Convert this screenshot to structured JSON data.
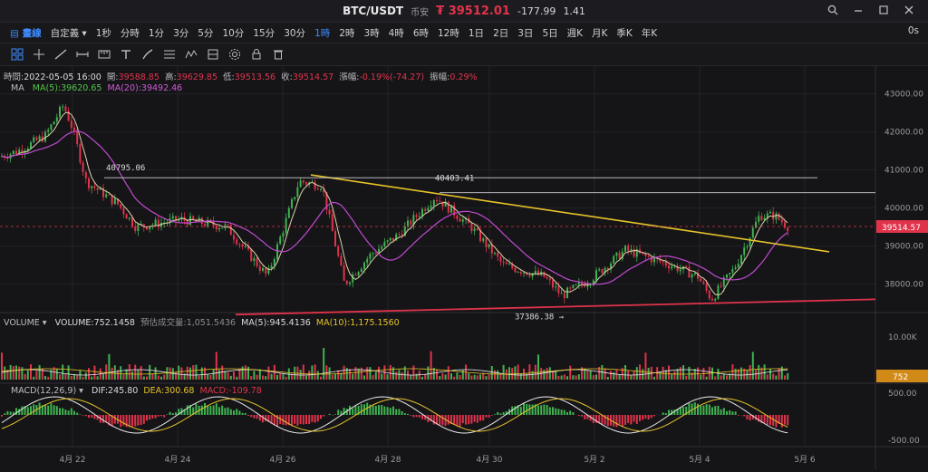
{
  "title": {
    "pair": "BTC/USDT",
    "venue": "币安",
    "price_symbol": "₮",
    "price": "39512.01",
    "change": "-177.99",
    "change_pct": "1.41"
  },
  "window": {
    "icons": [
      "search-icon",
      "minimize-icon",
      "restore-icon",
      "close-icon"
    ]
  },
  "intervals": {
    "brand": "畫線",
    "custom": "自定義",
    "items": [
      "1秒",
      "分時",
      "1分",
      "3分",
      "5分",
      "10分",
      "15分",
      "30分",
      "1時",
      "2時",
      "3時",
      "4時",
      "6時",
      "12時",
      "1日",
      "2日",
      "3日",
      "5日",
      "週K",
      "月K",
      "季K",
      "年K"
    ],
    "active": "1時",
    "seconds_badge": "0s"
  },
  "tools": [
    "grid-icon",
    "cursor-icon",
    "trendline-icon",
    "horizontal-line-icon",
    "ruler-icon",
    "text-icon",
    "brush-icon",
    "fib-icon",
    "pattern-icon",
    "layers-icon",
    "settings-icon",
    "lock-icon",
    "trash-icon"
  ],
  "ohlc": {
    "time_label": "時間:",
    "time": "2022-05-05 16:00",
    "open_label": "開:",
    "open": "39588.85",
    "high_label": "高:",
    "high": "39629.85",
    "low_label": "低:",
    "low": "39513.56",
    "close_label": "收:",
    "close": "39514.57",
    "change_label": "漲幅:",
    "change": "-0.19%(-74.27)",
    "amp_label": "振幅:",
    "amp": "0.29%"
  },
  "ma_legend": {
    "label": "MA",
    "ma5": "MA(5):39620.65",
    "ma20": "MA(20):39492.46"
  },
  "volume_legend": {
    "label": "VOLUME",
    "value": "VOLUME:752.1458",
    "estimate": "預估成交量:1,051.5436",
    "ma5": "MA(5):945.4136",
    "ma10": "MA(10):1,175.1560"
  },
  "macd_legend": {
    "label": "MACD(12,26,9)",
    "dif": "DIF:245.80",
    "dea": "DEA:300.68",
    "macd": "MACD:-109.78"
  },
  "price_axis": [
    "43000.00",
    "42000.00",
    "41000.00",
    "40000.00",
    "39000.00",
    "38000.00"
  ],
  "price_tag": "39514.57",
  "volume_axis": [
    "10.00K"
  ],
  "volume_tag": "752",
  "macd_axis": [
    "500.00",
    "-500.00"
  ],
  "date_labels": [
    "4月 22",
    "4月 24",
    "4月 26",
    "4月 28",
    "4月 30",
    "5月 2",
    "5月 4",
    "5月 6"
  ],
  "annotations": {
    "high_mark": "40795.06",
    "mid_mark": "40403.41",
    "low_mark": "37386.38 →"
  },
  "colors": {
    "up": "#3fb34f",
    "down": "#e0334a",
    "ma5": "#d8d4a8",
    "ma20": "#c04ad0",
    "trend_upper": "#e6c229",
    "trend_lower": "#e0334a",
    "accent": "#3d8bff"
  }
}
